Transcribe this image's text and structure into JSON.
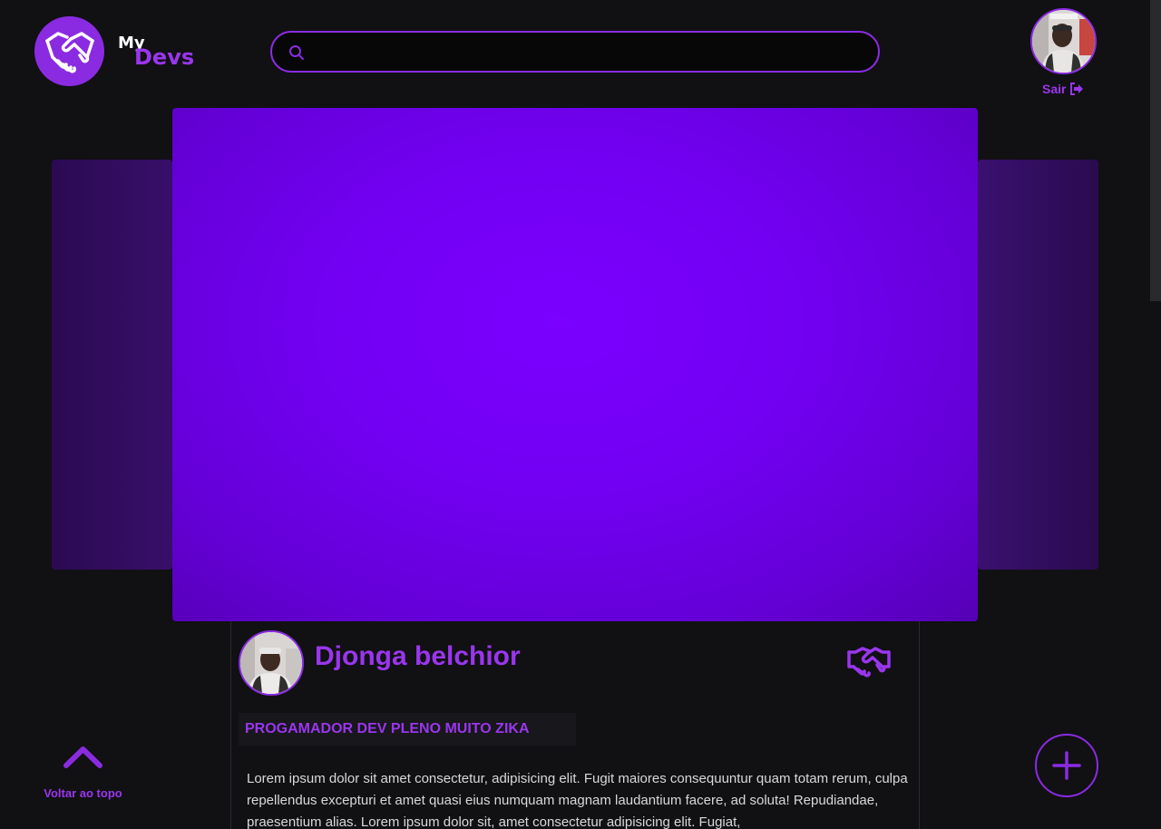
{
  "header": {
    "logo": {
      "word1": "My",
      "word2": "Devs",
      "icon": "handshake-icon"
    },
    "search": {
      "value": "",
      "placeholder": "",
      "icon": "search-icon"
    },
    "user": {
      "avatar": "user-photo",
      "logout_label": "Sair",
      "logout_icon": "sign-out-icon"
    }
  },
  "carousel": {
    "colors": {
      "main": "#7b00ff",
      "side": "#2b0a52"
    }
  },
  "post": {
    "author_name": "Djonga belchior",
    "role": "PROGAMADOR DEV PLENO MUITO ZIKA",
    "action_icon": "handshake-icon",
    "body": "Lorem ipsum dolor sit amet consectetur, adipisicing elit. Fugit maiores consequuntur quam totam rerum, culpa repellendus excepturi et amet quasi eius numquam magnam laudantium facere, ad soluta! Repudiandae, praesentium alias. Lorem ipsum dolor sit, amet consectetur adipisicing elit. Fugiat,"
  },
  "controls": {
    "back_to_top_label": "Voltar ao topo",
    "back_to_top_icon": "chevron-up-icon",
    "add_icon": "plus-icon"
  },
  "theme": {
    "accent": "#8a2be2",
    "accent_text": "#9a36ee",
    "background": "#111013"
  }
}
